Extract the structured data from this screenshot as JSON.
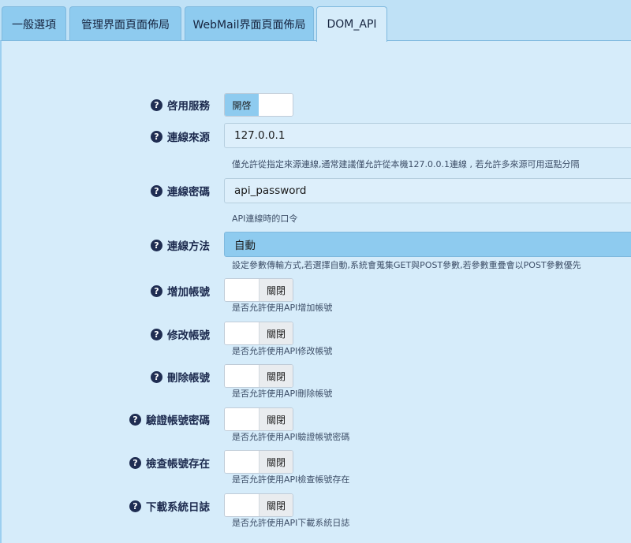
{
  "tabs": [
    {
      "label": "一般選項"
    },
    {
      "label": "管理界面頁面佈局"
    },
    {
      "label": "WebMail界面頁面佈局"
    },
    {
      "label": "DOM_API"
    }
  ],
  "help_glyph": "?",
  "fields": {
    "enable_service": {
      "label": "啓用服務",
      "state": "on",
      "on_label": "開啓"
    },
    "source": {
      "label": "連線來源",
      "value": "127.0.0.1",
      "hint": "僅允許從指定來源連線,通常建議僅允許從本機127.0.0.1連線 , 若允許多來源可用逗點分隔"
    },
    "password": {
      "label": "連線密碼",
      "value": "api_password",
      "hint": "API連線時的口令"
    },
    "method": {
      "label": "連線方法",
      "value": "自動",
      "hint": "設定參數傳輸方式,若選擇自動,系統會蒐集GET與POST參數,若參數重疊會以POST參數優先"
    },
    "add_account": {
      "label": "增加帳號",
      "state": "off",
      "off_label": "關閉",
      "hint": "是否允許使用API增加帳號"
    },
    "modify_account": {
      "label": "修改帳號",
      "state": "off",
      "off_label": "關閉",
      "hint": "是否允許使用API修改帳號"
    },
    "delete_account": {
      "label": "刪除帳號",
      "state": "off",
      "off_label": "關閉",
      "hint": "是否允許使用API刪除帳號"
    },
    "verify_password": {
      "label": "驗證帳號密碼",
      "state": "off",
      "off_label": "關閉",
      "hint": "是否允許使用API驗證帳號密碼"
    },
    "check_exists": {
      "label": "檢查帳號存在",
      "state": "off",
      "off_label": "關閉",
      "hint": "是否允許使用API檢查帳號存在"
    },
    "download_log": {
      "label": "下載系統日誌",
      "state": "off",
      "off_label": "關閉",
      "hint": "是否允許使用API下載系統日誌"
    }
  }
}
